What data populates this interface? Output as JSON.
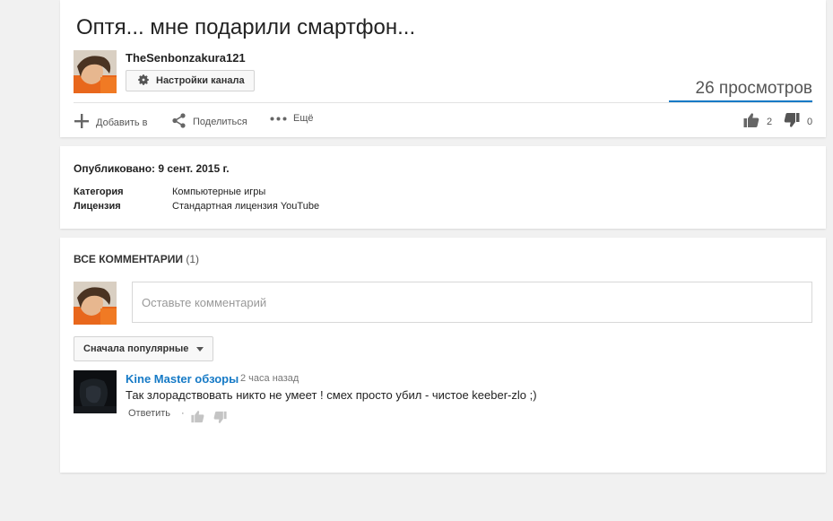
{
  "video": {
    "title": "Оптя... мне подарили смартфон...",
    "channel_name": "TheSenbonzakura121",
    "settings_button": "Настройки канала",
    "views": "26 просмотров",
    "actions": {
      "add": "Добавить в",
      "share": "Поделиться",
      "more": "Ещё"
    },
    "likes": "2",
    "dislikes": "0"
  },
  "meta": {
    "published": "Опубликовано: 9 сент. 2015 г.",
    "rows": [
      {
        "key": "Категория",
        "value": "Компьютерные игры"
      },
      {
        "key": "Лицензия",
        "value": "Стандартная лицензия YouTube"
      }
    ]
  },
  "comments": {
    "header": "ВСЕ КОММЕНТАРИИ",
    "count": "(1)",
    "placeholder": "Оставьте комментарий",
    "sort_label": "Сначала популярные",
    "items": [
      {
        "author": "Kine Master обзоры",
        "time": "2 часа назад",
        "text": "Так злорадствовать никто не умеет ! смех просто убил - чистое keeber-zlo  ;)",
        "reply": "Ответить",
        "separator": "·"
      }
    ]
  },
  "colors": {
    "accent": "#167ac6",
    "avatar_orange": "#e8671c",
    "background": "#f1f1f1"
  }
}
